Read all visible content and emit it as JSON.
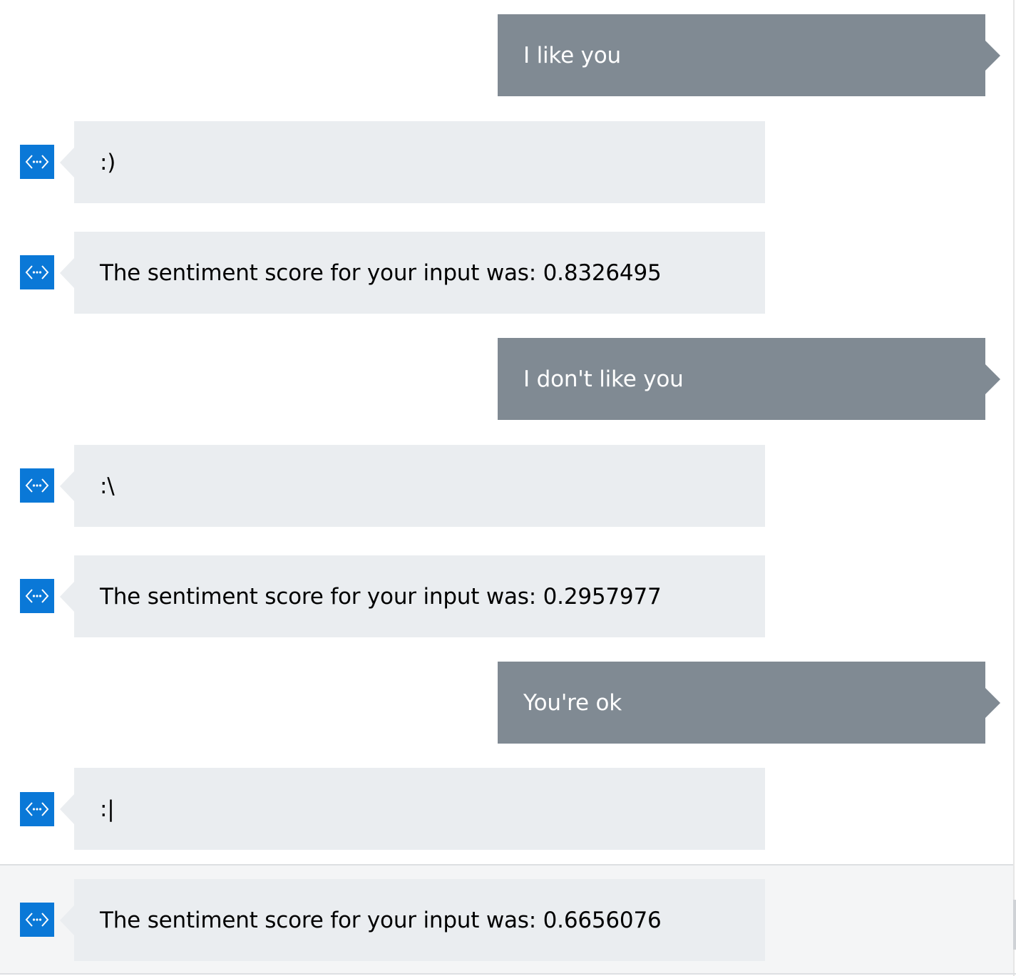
{
  "conversation": {
    "messages": [
      {
        "from": "user",
        "text": "I like you"
      },
      {
        "from": "bot",
        "icon": "code-brackets-icon",
        "text": ":)"
      },
      {
        "from": "bot",
        "icon": "code-brackets-icon",
        "text": "The sentiment score for your input was: 0.8326495"
      },
      {
        "from": "user",
        "text": "I don't like you"
      },
      {
        "from": "bot",
        "icon": "code-brackets-icon",
        "text": ":\\"
      },
      {
        "from": "bot",
        "icon": "code-brackets-icon",
        "text": "The sentiment score for your input was: 0.2957977"
      },
      {
        "from": "user",
        "text": "You're ok"
      },
      {
        "from": "bot",
        "icon": "code-brackets-icon",
        "text": ":|"
      },
      {
        "from": "bot",
        "icon": "code-brackets-icon",
        "text": "The sentiment score for your input was: 0.6656076"
      }
    ]
  },
  "colors": {
    "user_bubble": "#808a93",
    "bot_bubble": "#eaedf0",
    "bot_avatar": "#0a78d7",
    "user_text": "#ffffff",
    "bot_text": "#000000"
  }
}
